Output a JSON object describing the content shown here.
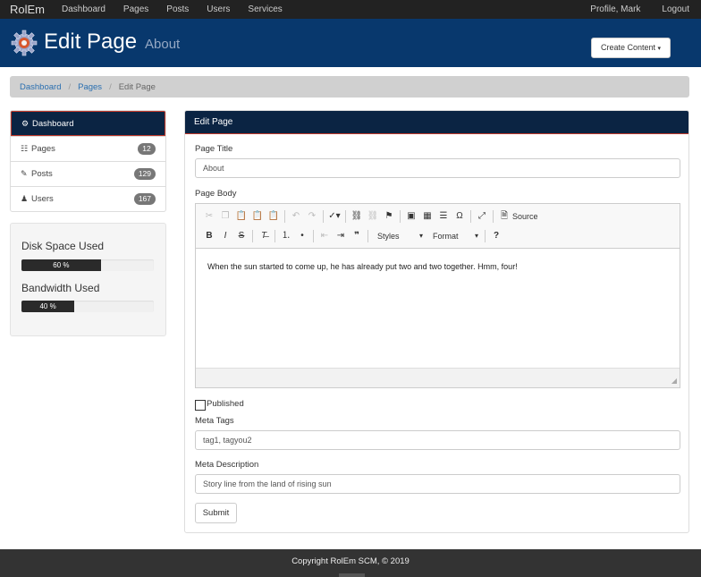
{
  "nav": {
    "brand": "RolEm",
    "links": [
      "Dashboard",
      "Pages",
      "Posts",
      "Users",
      "Services"
    ],
    "right": [
      "Profile, Mark",
      "Logout"
    ]
  },
  "header": {
    "title": "Edit Page",
    "subtitle": "About",
    "create_button": "Create Content"
  },
  "breadcrumb": {
    "items": [
      "Dashboard",
      "Pages",
      "Edit Page"
    ]
  },
  "sidebar": {
    "items": [
      {
        "label": "Dashboard",
        "icon": "gear-icon",
        "badge": ""
      },
      {
        "label": "Pages",
        "icon": "list-icon",
        "badge": "12"
      },
      {
        "label": "Posts",
        "icon": "pencil-icon",
        "badge": "129"
      },
      {
        "label": "Users",
        "icon": "user-icon",
        "badge": "167"
      }
    ],
    "usage": [
      {
        "label": "Disk Space Used",
        "percent": 60,
        "text": "60 %"
      },
      {
        "label": "Bandwidth Used",
        "percent": 40,
        "text": "40 %"
      }
    ]
  },
  "panel": {
    "title": "Edit Page",
    "page_title_label": "Page Title",
    "page_title_value": "About",
    "page_body_label": "Page Body",
    "body_text": "When the sun started to come up, he has already put two and two together. Hmm, four!",
    "toolbar": {
      "source_label": "Source",
      "styles_label": "Styles",
      "format_label": "Format"
    },
    "published_label": "Published",
    "meta_tags_label": "Meta Tags",
    "meta_tags_value": "tag1, tagyou2",
    "meta_desc_label": "Meta Description",
    "meta_desc_value": "Story line from the land of rising sun",
    "submit_label": "Submit"
  },
  "footer": {
    "text": "Copyright RolEm SCM, © 2019"
  },
  "colors": {
    "topbar": "#222222",
    "header": "#08386d",
    "panel_head": "#0b2443",
    "accent_border": "#c0392b",
    "link": "#2a6fb0"
  }
}
